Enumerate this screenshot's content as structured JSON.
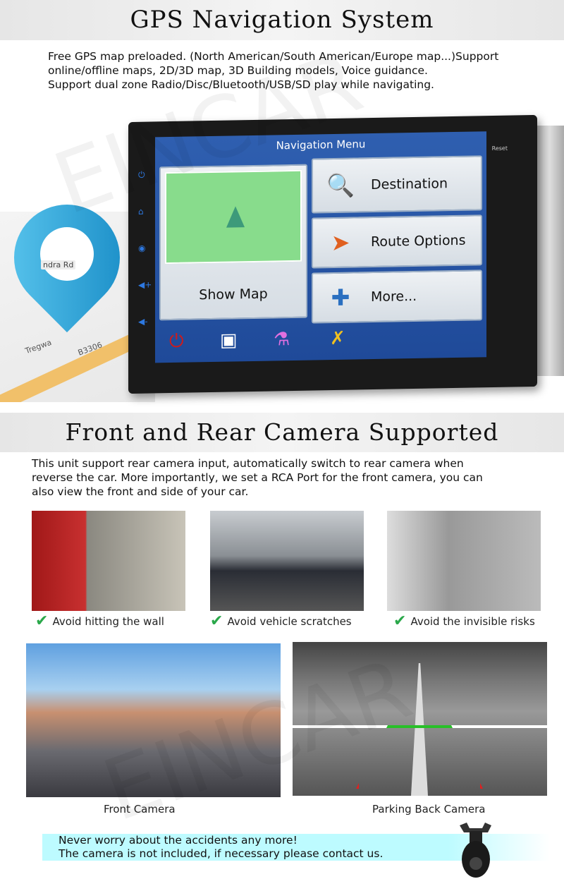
{
  "section1": {
    "title": "GPS Navigation System",
    "description": [
      "Free GPS map preloaded. (North American/South American/Europe map...)Support",
      "online/offline maps, 2D/3D map, 3D Building models, Voice guidance.",
      "Support dual zone Radio/Disc/Bluetooth/USB/SD play while navigating."
    ]
  },
  "map": {
    "labels": [
      "ndra Rd",
      "B3306",
      "Tregwa"
    ]
  },
  "device": {
    "reset_label": "Reset",
    "screen": {
      "title": "Navigation Menu",
      "show_map": "Show Map",
      "tiles": [
        {
          "label": "Destination",
          "icon": "magnifier-icon"
        },
        {
          "label": "Route Options",
          "icon": "route-icon"
        },
        {
          "label": "More...",
          "icon": "puzzle-icon"
        }
      ],
      "bottom_icons": [
        "power-icon",
        "traffic-icon",
        "flask-icon",
        "tools-icon"
      ]
    }
  },
  "watermark": "EINCAR®",
  "section2": {
    "title": "Front and Rear Camera Supported",
    "description": [
      "This unit support rear camera input, automatically switch to rear camera when",
      "reverse the car. More importantly, we set a RCA Port for the front camera, you can",
      "also view the front and side of your car."
    ]
  },
  "benefits": [
    "Avoid hitting the wall",
    "Avoid vehicle scratches",
    "Avoid the invisible risks"
  ],
  "cameras": [
    "Front Camera",
    "Parking Back Camera"
  ],
  "notice": [
    "Never worry about the accidents any more!",
    "The camera is not included, if necessary please contact us."
  ],
  "colors": {
    "check": "#2aa84a",
    "notice_bg": "#bdfbff",
    "screen": "#2f5fb0",
    "pin": "#1e9ad6"
  }
}
